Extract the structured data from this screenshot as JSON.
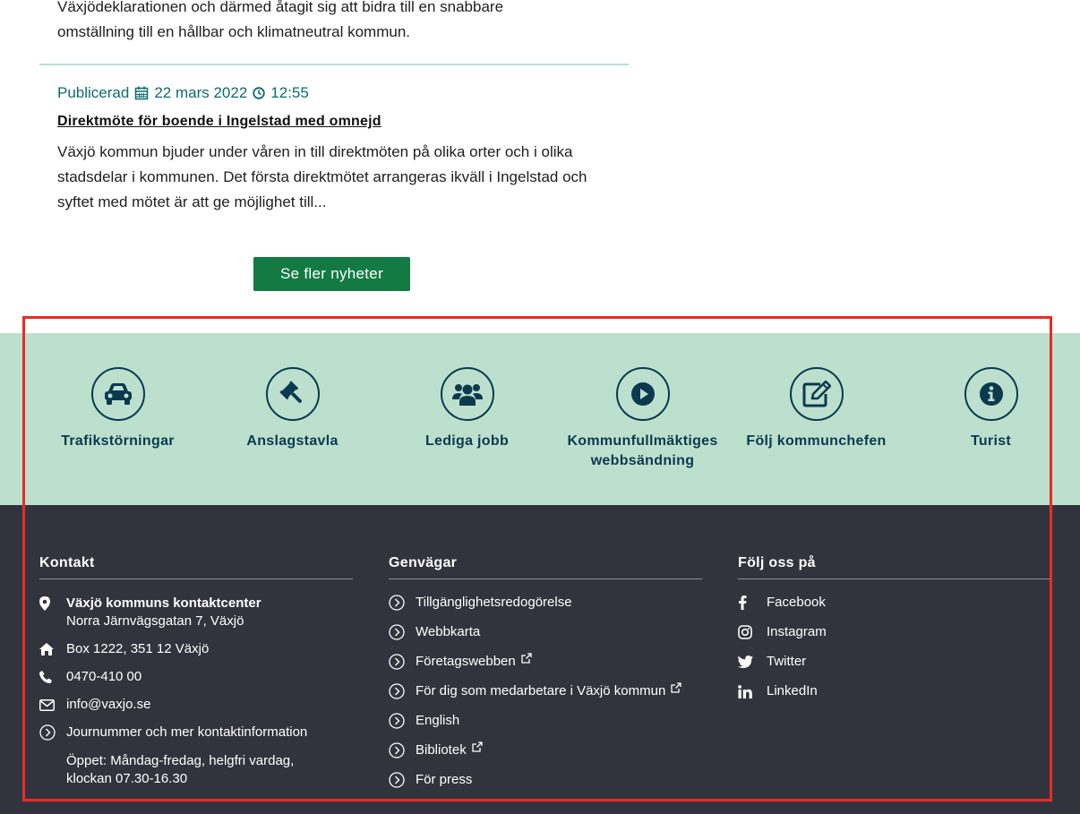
{
  "news": {
    "previous_excerpt_line1": "Växjödeklarationen och därmed åtagit sig att bidra till en snabbare",
    "previous_excerpt_line2": "omställning till en hållbar och klimatneutral kommun.",
    "published_label": "Publicerad",
    "published_date": "22 mars 2022",
    "published_time": "12:55",
    "headline": "Direktmöte för boende i Ingelstad med omnejd",
    "body": "Växjö kommun bjuder under våren in till direktmöten på olika orter och i olika stadsdelar i kommunen. Det första direktmötet arrangeras ikväll i Ingelstad och syftet med mötet är att ge möjlighet till...",
    "more_button": "Se fler nyheter"
  },
  "quick_links": [
    {
      "label": "Trafikstörningar",
      "icon": "car-icon"
    },
    {
      "label": "Anslagstavla",
      "icon": "gavel-icon"
    },
    {
      "label": "Lediga jobb",
      "icon": "users-icon"
    },
    {
      "label_line1": "Kommunfullmäktiges",
      "label_line2": "webbsändning",
      "icon": "play-icon"
    },
    {
      "label": "Följ kommunchefen",
      "icon": "edit-icon"
    },
    {
      "label": "Turist",
      "icon": "info-icon"
    }
  ],
  "footer": {
    "contact": {
      "heading": "Kontakt",
      "center_name": "Växjö kommuns kontaktcenter",
      "street": "Norra Järnvägsgatan 7, Växjö",
      "box": "Box 1222, 351 12 Växjö",
      "phone": "0470-410 00",
      "email": "info@vaxjo.se",
      "more_link": "Journummer och mer kontaktinformation",
      "open_line1": "Öppet: Måndag-fredag, helgfri vardag,",
      "open_line2": "klockan 07.30-16.30"
    },
    "shortcuts": {
      "heading": "Genvägar",
      "items": [
        {
          "label": "Tillgänglighetsredogörelse",
          "external": false
        },
        {
          "label": "Webbkarta",
          "external": false
        },
        {
          "label": "Företagswebben",
          "external": true
        },
        {
          "label": "För dig som medarbetare i Växjö kommun",
          "external": true
        },
        {
          "label": "English",
          "external": false
        },
        {
          "label": "Bibliotek",
          "external": true
        },
        {
          "label": "För press",
          "external": false
        }
      ]
    },
    "follow": {
      "heading": "Följ oss på",
      "items": [
        {
          "label": "Facebook",
          "icon": "facebook-icon"
        },
        {
          "label": "Instagram",
          "icon": "instagram-icon"
        },
        {
          "label": "Twitter",
          "icon": "twitter-icon"
        },
        {
          "label": "LinkedIn",
          "icon": "linkedin-icon"
        }
      ]
    }
  },
  "colors": {
    "primary_green": "#137a44",
    "mint_band": "#bde0ce",
    "navy": "#0b3a4f",
    "footer_bg": "#31343d",
    "highlight": "#ee2a24",
    "teal_meta": "#0d6b6e"
  }
}
